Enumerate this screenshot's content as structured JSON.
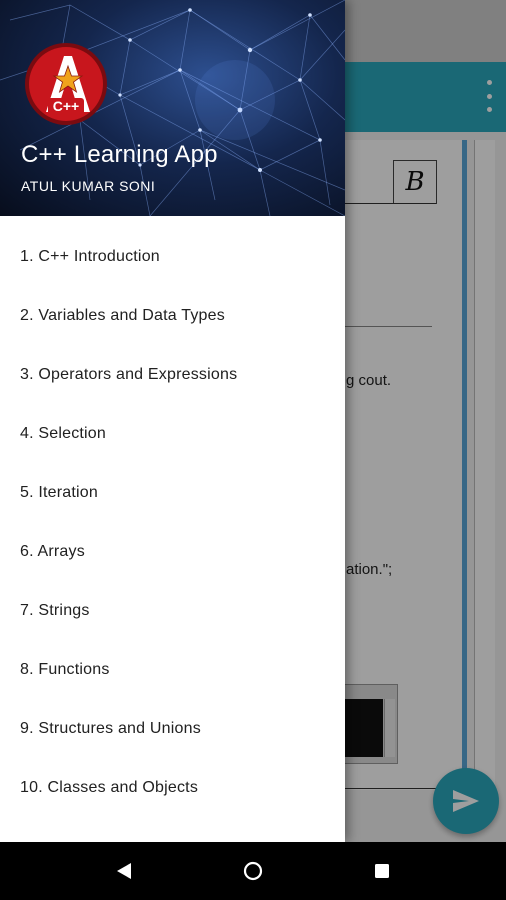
{
  "drawer": {
    "title": "C++ Learning App",
    "subtitle": "ATUL KUMAR SONI",
    "logo_text": "C++",
    "items": [
      {
        "label": "1. C++ Introduction"
      },
      {
        "label": "2. Variables and Data Types"
      },
      {
        "label": "3. Operators and Expressions"
      },
      {
        "label": "4. Selection"
      },
      {
        "label": "5. Iteration"
      },
      {
        "label": "6. Arrays"
      },
      {
        "label": "7. Strings"
      },
      {
        "label": "8. Functions"
      },
      {
        "label": "9. Structures and Unions"
      },
      {
        "label": "10. Classes and Objects"
      }
    ]
  },
  "background": {
    "text_line_1": "g cout.",
    "text_line_2": "ation.\";"
  },
  "icons": {
    "overflow": "more-vert-icon",
    "fab": "send-icon",
    "back": "back-icon",
    "home": "home-icon",
    "recents": "recents-icon"
  },
  "colors": {
    "accent": "#2aa8bd",
    "logo_red": "#c8161d",
    "logo_star": "#f0a31c"
  }
}
